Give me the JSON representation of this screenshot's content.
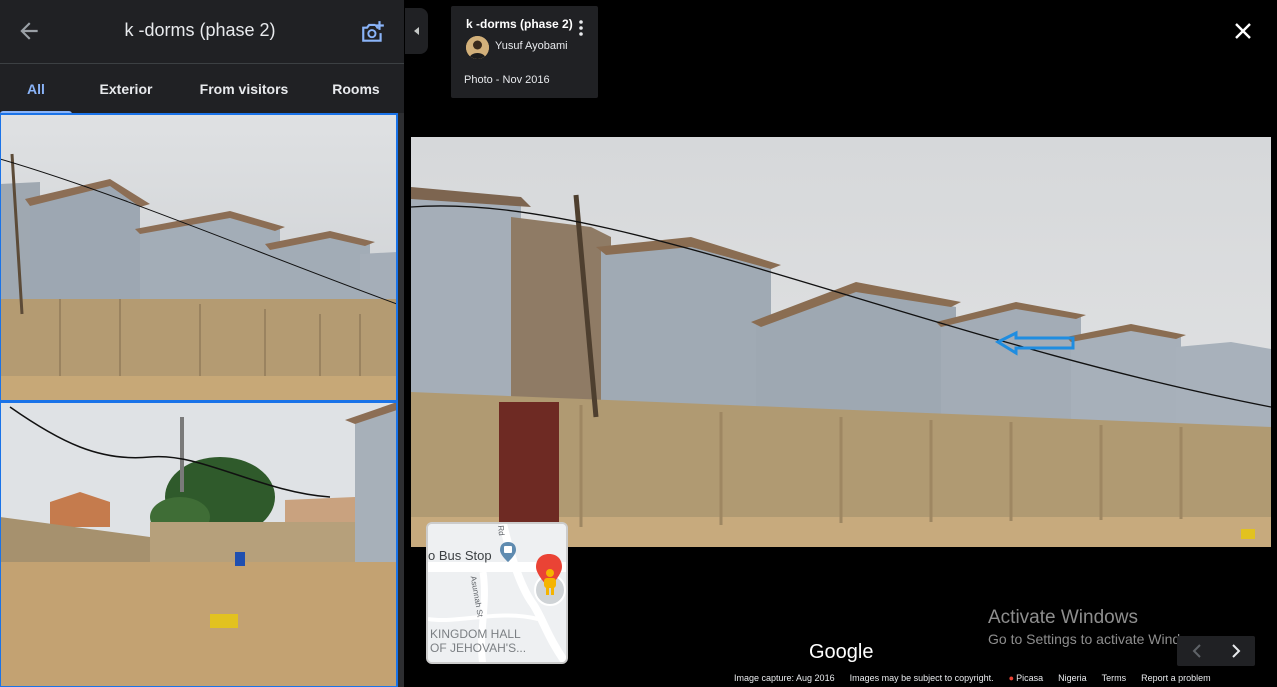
{
  "header": {
    "title": "k -dorms (phase 2)"
  },
  "tabs": [
    {
      "label": "All",
      "active": true
    },
    {
      "label": "Exterior",
      "active": false
    },
    {
      "label": "From visitors",
      "active": false
    },
    {
      "label": "Rooms",
      "active": false
    }
  ],
  "info_card": {
    "title": "k -dorms (phase 2)",
    "author": "Yusuf Ayobami",
    "date": "Photo - Nov 2016"
  },
  "minimap": {
    "place_1": "o Bus Stop",
    "street": "Asunnah St",
    "street_2": "Rd",
    "place_2_line1": "KINGDOM HALL",
    "place_2_line2": "OF JEHOVAH'S..."
  },
  "watermark": {
    "line1": "Activate Windows",
    "line2": "Go to Settings to activate Windows."
  },
  "brand": "Google",
  "footer": {
    "capture": "Image capture: Aug 2016",
    "copyright": "Images may be subject to copyright.",
    "source": "Picasa",
    "country": "Nigeria",
    "terms": "Terms",
    "report": "Report a problem"
  },
  "colors": {
    "accent": "#8ab4f8",
    "panel_bg": "#202124",
    "selected_outline": "#1a73e8"
  },
  "icons": [
    "back-arrow-icon",
    "add-photo-icon",
    "close-icon",
    "more-vert-icon",
    "collapse-chevron-icon",
    "chevron-left-icon",
    "chevron-right-icon",
    "pegman-icon",
    "bus-stop-icon"
  ]
}
